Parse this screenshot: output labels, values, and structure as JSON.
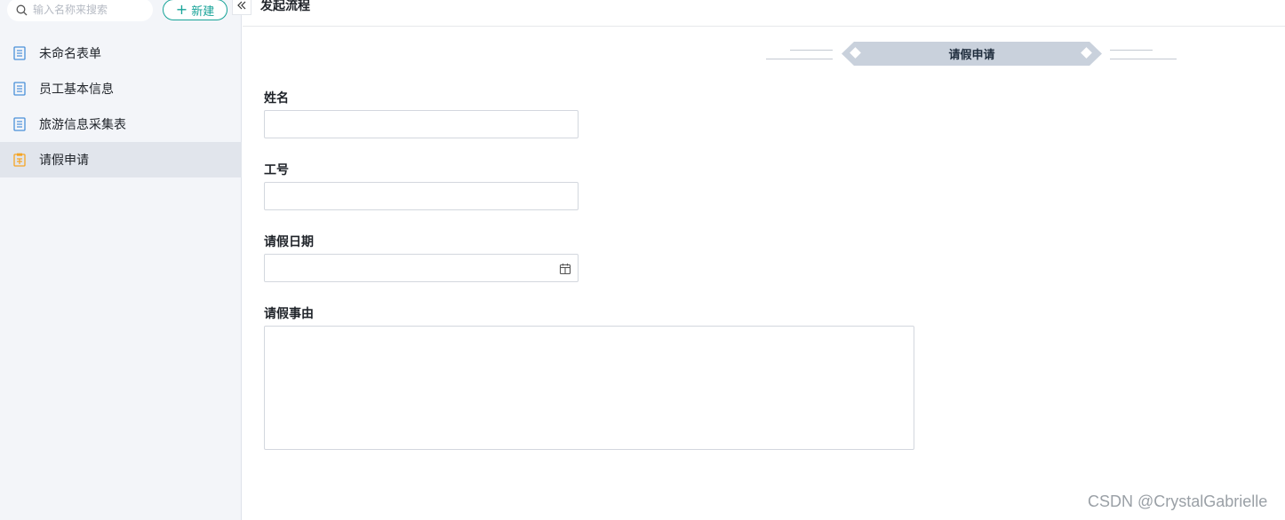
{
  "sidebar": {
    "search_placeholder": "输入名称来搜索",
    "new_button": "新建",
    "items": [
      {
        "label": "未命名表单",
        "icon": "document-icon"
      },
      {
        "label": "员工基本信息",
        "icon": "document-icon"
      },
      {
        "label": "旅游信息采集表",
        "icon": "document-icon"
      },
      {
        "label": "请假申请",
        "icon": "clipboard-icon",
        "active": true
      }
    ]
  },
  "header": {
    "title": "发起流程"
  },
  "form": {
    "title": "请假申请",
    "fields": [
      {
        "label": "姓名",
        "value": ""
      },
      {
        "label": "工号",
        "value": ""
      },
      {
        "label": "请假日期",
        "value": ""
      },
      {
        "label": "请假事由",
        "value": ""
      }
    ]
  },
  "watermark": "CSDN @CrystalGabrielle",
  "colors": {
    "accent": "#17a398",
    "sidebar_bg": "#f3f5f9",
    "active_item_bg": "#e1e5ec",
    "banner_bg": "#c9d1dc",
    "doc_icon": "#4a90d9",
    "clipboard_icon": "#f5a524"
  }
}
